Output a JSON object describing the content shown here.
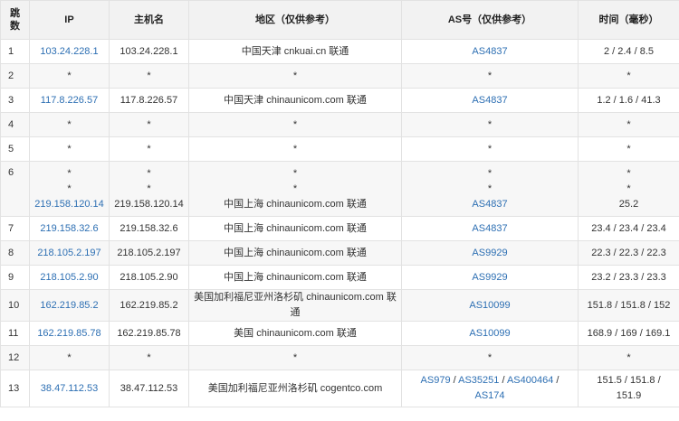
{
  "headers": {
    "hop": "跳数",
    "ip": "IP",
    "hostname": "主机名",
    "region": "地区（仅供参考）",
    "as": "AS号（仅供参考）",
    "time": "时间（毫秒）"
  },
  "colors": {
    "link": "#2d6fb3",
    "header_bg": "#f2f2f2",
    "border": "#e2e2e2",
    "zebra": "#f7f7f7"
  },
  "rows": [
    {
      "hop": "1",
      "ip": "103.24.228.1",
      "hostname": "103.24.228.1",
      "region": "中国天津 cnkuai.cn 联通",
      "as": "AS4837",
      "time": "2 / 2.4 / 8.5"
    },
    {
      "hop": "2",
      "ip": "*",
      "hostname": "*",
      "region": "*",
      "as": "*",
      "time": "*"
    },
    {
      "hop": "3",
      "ip": "117.8.226.57",
      "hostname": "117.8.226.57",
      "region": "中国天津 chinaunicom.com 联通",
      "as": "AS4837",
      "time": "1.2 / 1.6 / 41.3"
    },
    {
      "hop": "4",
      "ip": "*",
      "hostname": "*",
      "region": "*",
      "as": "*",
      "time": "*"
    },
    {
      "hop": "5",
      "ip": "*",
      "hostname": "*",
      "region": "*",
      "as": "*",
      "time": "*"
    },
    {
      "hop": "6",
      "ip_lines": [
        "*",
        "*",
        "219.158.120.14"
      ],
      "hostname_lines": [
        "*",
        "*",
        "219.158.120.14"
      ],
      "region_lines": [
        "*",
        "*",
        "中国上海 chinaunicom.com 联通"
      ],
      "as_lines": [
        "*",
        "*",
        "AS4837"
      ],
      "time_lines": [
        "*",
        "*",
        "25.2"
      ]
    },
    {
      "hop": "7",
      "ip": "219.158.32.6",
      "hostname": "219.158.32.6",
      "region": "中国上海 chinaunicom.com 联通",
      "as": "AS4837",
      "time": "23.4 / 23.4 / 23.4"
    },
    {
      "hop": "8",
      "ip": "218.105.2.197",
      "hostname": "218.105.2.197",
      "region": "中国上海 chinaunicom.com 联通",
      "as": "AS9929",
      "time": "22.3 / 22.3 / 22.3"
    },
    {
      "hop": "9",
      "ip": "218.105.2.90",
      "hostname": "218.105.2.90",
      "region": "中国上海 chinaunicom.com 联通",
      "as": "AS9929",
      "time": "23.2 / 23.3 / 23.3"
    },
    {
      "hop": "10",
      "ip": "162.219.85.2",
      "hostname": "162.219.85.2",
      "region": "美国加利福尼亚州洛杉矶 chinaunicom.com 联通",
      "as": "AS10099",
      "time": "151.8 / 151.8 / 152"
    },
    {
      "hop": "11",
      "ip": "162.219.85.78",
      "hostname": "162.219.85.78",
      "region": "美国 chinaunicom.com 联通",
      "as": "AS10099",
      "time": "168.9 / 169 / 169.1"
    },
    {
      "hop": "12",
      "ip": "*",
      "hostname": "*",
      "region": "*",
      "as": "*",
      "time": "*"
    },
    {
      "hop": "13",
      "ip": "38.47.112.53",
      "hostname": "38.47.112.53",
      "region": "美国加利福尼亚州洛杉矶 cogentco.com",
      "as_links": [
        "AS979",
        "AS35251",
        "AS400464",
        "AS174"
      ],
      "as_sep": " / ",
      "time_lines": [
        "151.5 / 151.8 /",
        "151.9"
      ]
    }
  ]
}
